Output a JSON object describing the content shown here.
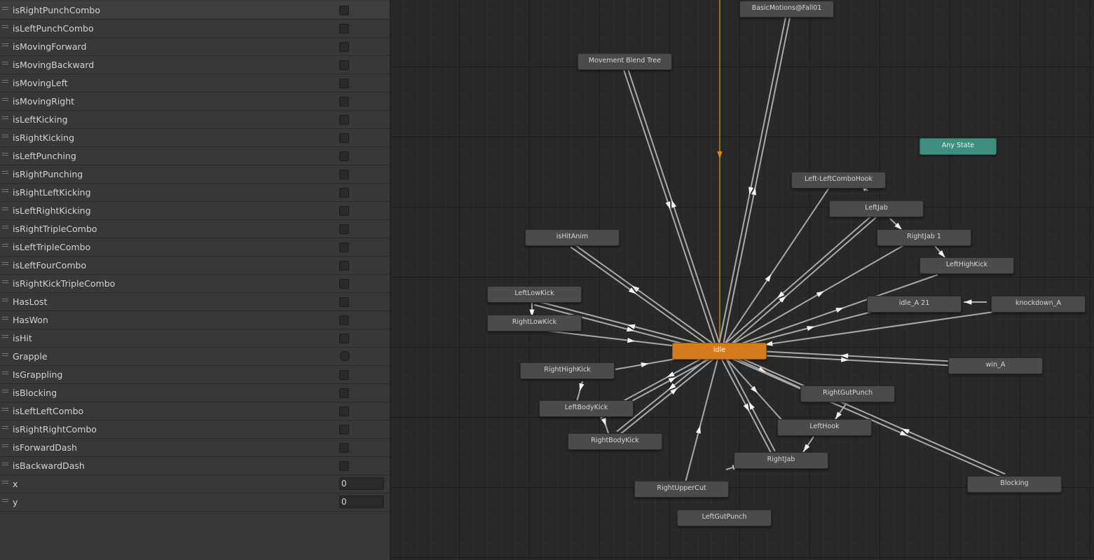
{
  "parameters": [
    {
      "name": "isRightPunchCombo",
      "type": "bool",
      "value": false
    },
    {
      "name": "isLeftPunchCombo",
      "type": "bool",
      "value": false
    },
    {
      "name": "isMovingForward",
      "type": "bool",
      "value": false
    },
    {
      "name": "isMovingBackward",
      "type": "bool",
      "value": false
    },
    {
      "name": "isMovingLeft",
      "type": "bool",
      "value": false
    },
    {
      "name": "isMovingRight",
      "type": "bool",
      "value": false
    },
    {
      "name": "isLeftKicking",
      "type": "bool",
      "value": false
    },
    {
      "name": "isRightKicking",
      "type": "bool",
      "value": false
    },
    {
      "name": "isLeftPunching",
      "type": "bool",
      "value": false
    },
    {
      "name": "isRightPunching",
      "type": "bool",
      "value": false
    },
    {
      "name": "isRightLeftKicking",
      "type": "bool",
      "value": false
    },
    {
      "name": "isLeftRightKicking",
      "type": "bool",
      "value": false
    },
    {
      "name": "isRightTripleCombo",
      "type": "bool",
      "value": false
    },
    {
      "name": "isLeftTripleCombo",
      "type": "bool",
      "value": false
    },
    {
      "name": "isLeftFourCombo",
      "type": "bool",
      "value": false
    },
    {
      "name": "isRightKickTripleCombo",
      "type": "bool",
      "value": false
    },
    {
      "name": "HasLost",
      "type": "bool",
      "value": false
    },
    {
      "name": "HasWon",
      "type": "bool",
      "value": false
    },
    {
      "name": "isHit",
      "type": "bool",
      "value": false
    },
    {
      "name": "Grapple",
      "type": "trigger",
      "value": false
    },
    {
      "name": "IsGrappling",
      "type": "bool",
      "value": false
    },
    {
      "name": "isBlocking",
      "type": "bool",
      "value": false
    },
    {
      "name": "isLeftLeftCombo",
      "type": "bool",
      "value": false
    },
    {
      "name": "isRightRightCombo",
      "type": "bool",
      "value": false
    },
    {
      "name": "isForwardDash",
      "type": "bool",
      "value": false
    },
    {
      "name": "isBackwardDash",
      "type": "bool",
      "value": false
    },
    {
      "name": "x",
      "type": "float",
      "value": "0"
    },
    {
      "name": "y",
      "type": "float",
      "value": "0"
    }
  ],
  "states": [
    {
      "id": "basic_fall",
      "label": "BasicMotions@Fall01",
      "kind": "state"
    },
    {
      "id": "movement_blend",
      "label": "Movement Blend Tree",
      "kind": "state"
    },
    {
      "id": "any_state",
      "label": "Any State",
      "kind": "any"
    },
    {
      "id": "left_left_hook",
      "label": "Left-LeftComboHook",
      "kind": "state"
    },
    {
      "id": "left_jab",
      "label": "LeftJab",
      "kind": "state"
    },
    {
      "id": "right_jab_1",
      "label": "RightJab 1",
      "kind": "state"
    },
    {
      "id": "left_high_kick",
      "label": "LeftHighKick",
      "kind": "state"
    },
    {
      "id": "is_hit_anim",
      "label": "isHitAnim",
      "kind": "state"
    },
    {
      "id": "left_low_kick",
      "label": "LeftLowKick",
      "kind": "state"
    },
    {
      "id": "right_low_kick",
      "label": "RightLowKick",
      "kind": "state"
    },
    {
      "id": "idle_a21",
      "label": "idle_A 21",
      "kind": "state"
    },
    {
      "id": "knockdown",
      "label": "knockdown_A",
      "kind": "state"
    },
    {
      "id": "idle",
      "label": "idle",
      "kind": "default"
    },
    {
      "id": "win_a",
      "label": "win_A",
      "kind": "state"
    },
    {
      "id": "right_high_kick",
      "label": "RightHighKick",
      "kind": "state"
    },
    {
      "id": "right_gut_punch",
      "label": "RightGutPunch",
      "kind": "state"
    },
    {
      "id": "left_body_kick",
      "label": "LeftBodyKick",
      "kind": "state"
    },
    {
      "id": "left_hook",
      "label": "LeftHook",
      "kind": "state"
    },
    {
      "id": "right_body_kick",
      "label": "RightBodyKick",
      "kind": "state"
    },
    {
      "id": "right_jab",
      "label": "RightJab",
      "kind": "state"
    },
    {
      "id": "right_upper_cut",
      "label": "RightUpperCut",
      "kind": "state"
    },
    {
      "id": "blocking",
      "label": "Blocking",
      "kind": "state"
    },
    {
      "id": "left_gut_punch",
      "label": "LeftGutPunch",
      "kind": "state"
    }
  ],
  "colors": {
    "transition": "#a9a9a9",
    "entry_transition": "#b8860b",
    "default_state": "#d67b1d",
    "any_state": "#3f8f80"
  }
}
